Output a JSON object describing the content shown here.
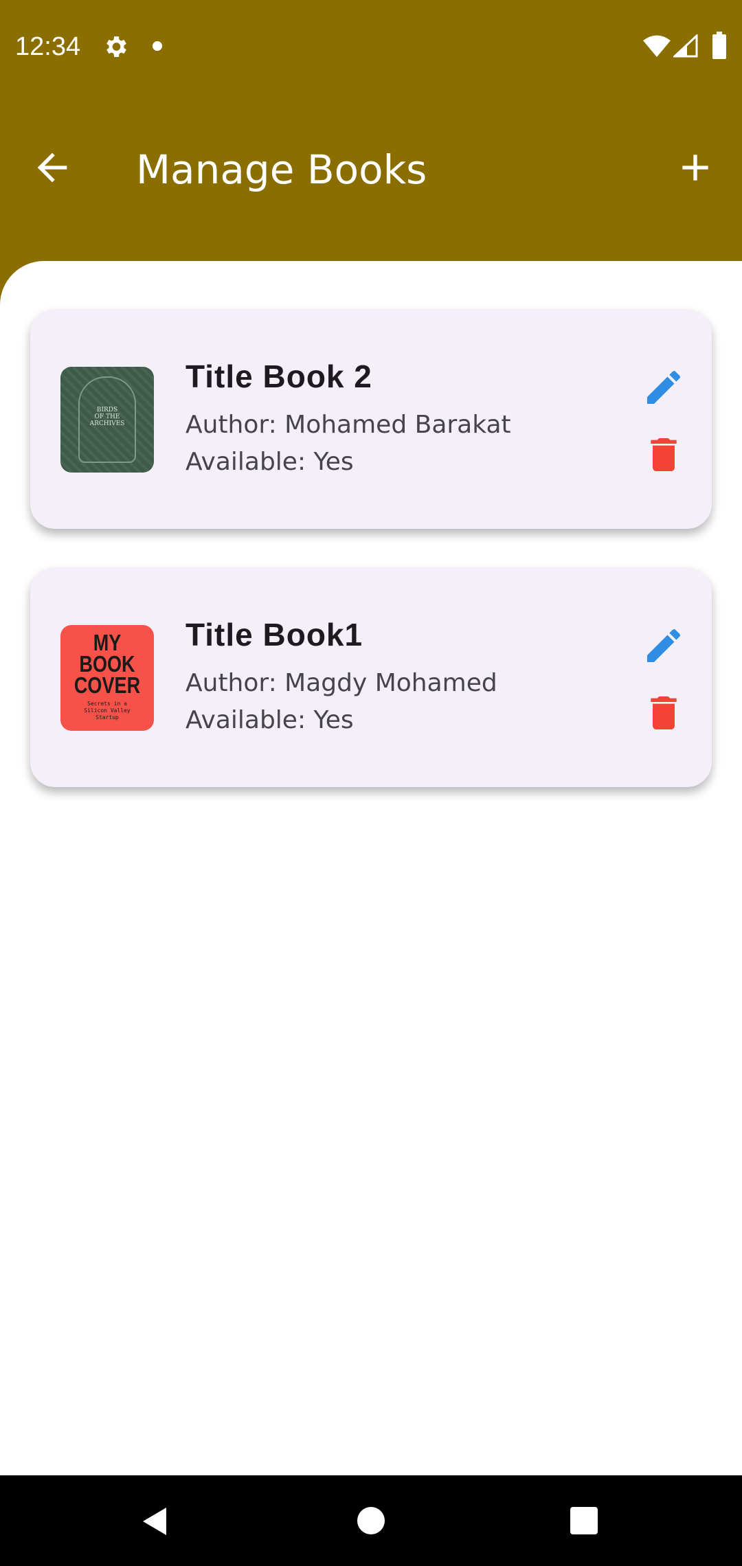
{
  "colors": {
    "app_bar": "#8b6e00",
    "card_background": "#f4eff8",
    "edit_icon": "#2f8de4",
    "delete_icon": "#f44336",
    "title_text": "#1d1b20",
    "secondary_text": "#45434b"
  },
  "status_bar": {
    "time": "12:34",
    "icons": [
      "gear-icon",
      "notification-dot-icon",
      "wifi-icon",
      "signal-icon",
      "battery-icon"
    ]
  },
  "app_bar": {
    "title": "Manage Books",
    "back_icon": "arrow-left-icon",
    "add_icon": "plus-icon"
  },
  "books": [
    {
      "title": "Title Book 2",
      "author": "Author: Mohamed Barakat",
      "available": "Available: Yes",
      "cover": {
        "style": "green-ornate",
        "text_lines": [
          "BIRDS",
          "OF THE",
          "ARCHIVES"
        ]
      }
    },
    {
      "title": "Title Book1",
      "author": "Author: Magdy Mohamed",
      "available": "Available: Yes",
      "cover": {
        "style": "red-bold",
        "title_lines": [
          "MY",
          "BOOK",
          "COVER"
        ],
        "subtitle_lines": [
          "Secrets in a",
          "Silicon Valley",
          "Startup"
        ]
      }
    }
  ],
  "nav_bar": {
    "icons": [
      "nav-back-icon",
      "nav-home-icon",
      "nav-recents-icon"
    ]
  }
}
